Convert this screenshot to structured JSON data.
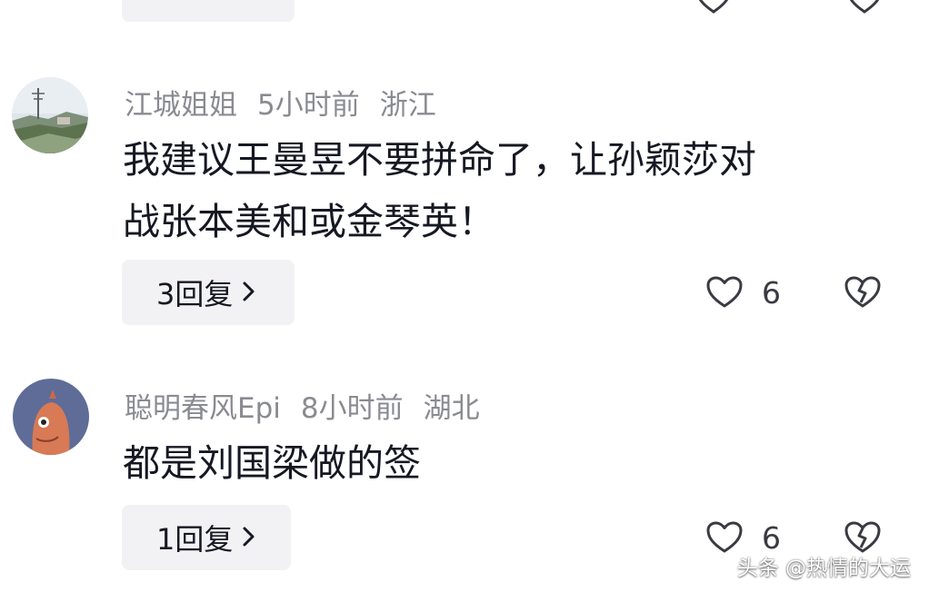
{
  "comments": [
    {
      "username": "江城姐姐",
      "time": "5小时前",
      "location": "浙江",
      "text_line1": "我建议王曼昱不要拼命了，让孙颖莎对",
      "text_line2": "战张本美和或金琴英！",
      "reply_label": "3回复",
      "likes": "6",
      "avatar_icon": "landscape-photo-avatar"
    },
    {
      "username": "聪明春风Epi",
      "time": "8小时前",
      "location": "湖北",
      "text_line1": "都是刘国梁做的签",
      "reply_label": "1回复",
      "likes": "6",
      "avatar_icon": "cartoon-character-avatar"
    }
  ],
  "watermark": "头条 @热情的大运",
  "colors": {
    "meta_text": "#8a8b91",
    "pill_bg": "#f2f2f4",
    "body_text": "#161823",
    "avatar2_bg": "#5f6c97"
  }
}
